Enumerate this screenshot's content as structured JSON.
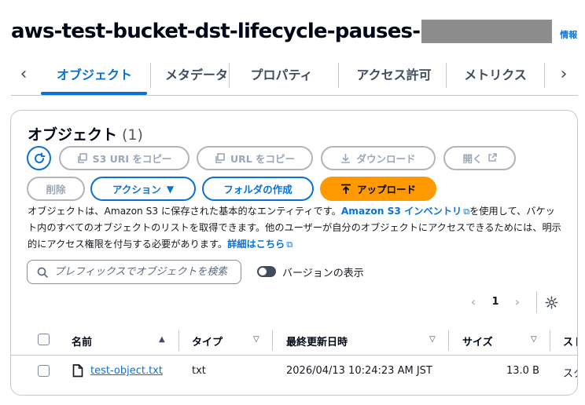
{
  "header": {
    "title": "aws-test-bucket-dst-lifecycle-pauses-",
    "info_link": "情報"
  },
  "tabs": [
    {
      "label": "オブジェクト",
      "active": true
    },
    {
      "label": "メタデータ"
    },
    {
      "label": "プロパティ"
    },
    {
      "label": "アクセス許可"
    },
    {
      "label": "メトリクス"
    }
  ],
  "panel": {
    "title": "オブジェクト",
    "count": "(1)"
  },
  "toolbar": {
    "copy_s3_uri": "S3 URI をコピー",
    "copy_url": "URL をコピー",
    "download": "ダウンロード",
    "open": "開く",
    "delete": "削除",
    "actions": "アクション",
    "create_folder": "フォルダの作成",
    "upload": "アップロード"
  },
  "description": {
    "part1": "オブジェクトは、Amazon S3 に保存された基本的なエンティティです。",
    "link1": "Amazon S3 インベントリ",
    "part2": "を使用して、バケット内のすべてのオブジェクトのリストを取得できます。他のユーザーが自分のオブジェクトにアクセスできるためには、明示的にアクセス権限を付与する必要があります。",
    "link2": "詳細はこちら"
  },
  "search": {
    "placeholder": "プレフィックスでオブジェクトを検索"
  },
  "versions_toggle": {
    "label": "バージョンの表示",
    "on": false
  },
  "pagination": {
    "page": "1"
  },
  "table": {
    "columns": [
      "名前",
      "タイプ",
      "最終更新日時",
      "サイズ",
      "ストレージクラス"
    ],
    "rows": [
      {
        "name": "test-object.txt",
        "type": "txt",
        "modified": "2026/04/13 10:24:23 AM JST",
        "size": "13.0 B",
        "storage": "スタンダード"
      }
    ]
  },
  "colors": {
    "accent": "#0972d3",
    "upload": "#ff9900",
    "border": "#c6c6cd"
  }
}
